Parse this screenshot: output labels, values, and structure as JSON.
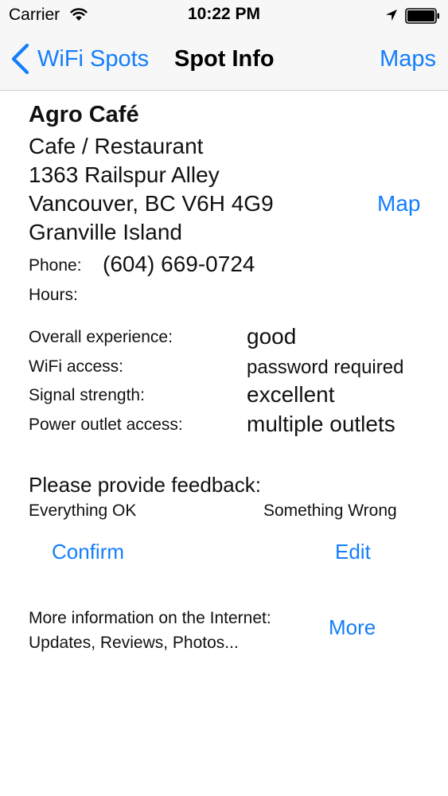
{
  "status_bar": {
    "carrier": "Carrier",
    "time": "10:22 PM",
    "icons": [
      "wifi-icon",
      "location-arrow-icon",
      "battery-icon"
    ]
  },
  "nav": {
    "back_label": "WiFi Spots",
    "title": "Spot Info",
    "right_label": "Maps"
  },
  "spot": {
    "name": "Agro Café",
    "category": "Cafe / Restaurant",
    "street": "1363 Railspur Alley",
    "city": "Vancouver, BC V6H 4G9",
    "area": "Granville Island",
    "map_link": "Map",
    "phone_label": "Phone:",
    "phone": "(604) 669-0724",
    "hours_label": "Hours:"
  },
  "ratings": [
    {
      "label": "Overall experience:",
      "value": "good"
    },
    {
      "label": "WiFi access:",
      "value": "password required"
    },
    {
      "label": "Signal strength:",
      "value": "excellent"
    },
    {
      "label": "Power outlet access:",
      "value": "multiple outlets"
    }
  ],
  "feedback": {
    "heading": "Please provide feedback:",
    "ok_label": "Everything OK",
    "wrong_label": "Something Wrong",
    "confirm_button": "Confirm",
    "edit_button": "Edit"
  },
  "more": {
    "line1": "More information on the Internet:",
    "line2": "Updates, Reviews, Photos...",
    "button": "More"
  },
  "colors": {
    "accent": "#147efb",
    "bar_background": "#f7f7f7",
    "text": "#111111"
  }
}
